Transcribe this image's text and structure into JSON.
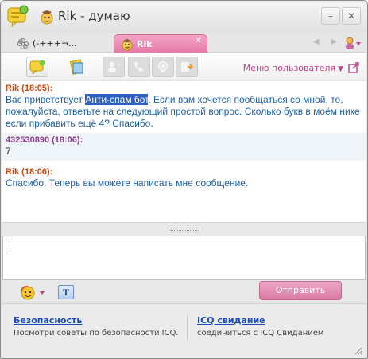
{
  "window": {
    "title": "Rik - думаю",
    "buttons": [
      "–",
      "✕"
    ]
  },
  "tabs": [
    {
      "label": "(-+++¬...",
      "active": false
    },
    {
      "label": "Rik",
      "active": true
    }
  ],
  "toolbar": {
    "user_menu_label": "Меню пользователя"
  },
  "messages": [
    {
      "author": "Rik",
      "time": "18:05",
      "header": "Rik (18:05):",
      "text_before": "Вас приветствует ",
      "text_highlight": "Анти-спам бот",
      "text_after": ". Если вам хочется пообщаться со мной, то, пожалуйста, ответьте на следующий простой вопрос. Сколько букв в моём нике если прибавить ещё 4? Спасибо."
    },
    {
      "author": "432530890",
      "time": "18:06",
      "header": "432530890 (18:06):",
      "text": "7"
    },
    {
      "author": "Rik",
      "time": "18:06",
      "header": "Rik (18:06):",
      "text": "Спасибо. Теперь вы можете написать мне сообщение."
    }
  ],
  "compose": {
    "value": "",
    "send_label": "Отправить",
    "format_label": "T"
  },
  "promos": [
    {
      "title": "Безопасность",
      "text": "Посмотри советы по безопасности ICQ."
    },
    {
      "title": "ICQ свидание",
      "text": "соединиться с ICQ Свиданием"
    }
  ],
  "colors": {
    "accent_pink": "#e579a6",
    "author_rik": "#c44b14",
    "author_other": "#8a3a8e",
    "message_text": "#1a5fa8",
    "link": "#1a49b8"
  },
  "icons": [
    "icq-flower-icon",
    "user-status-icon",
    "chat-icon",
    "notes-icon",
    "add-user-icon",
    "call-icon",
    "webcam-icon",
    "send-file-icon",
    "popout-icon",
    "smiley-icon",
    "contacts-icon"
  ]
}
